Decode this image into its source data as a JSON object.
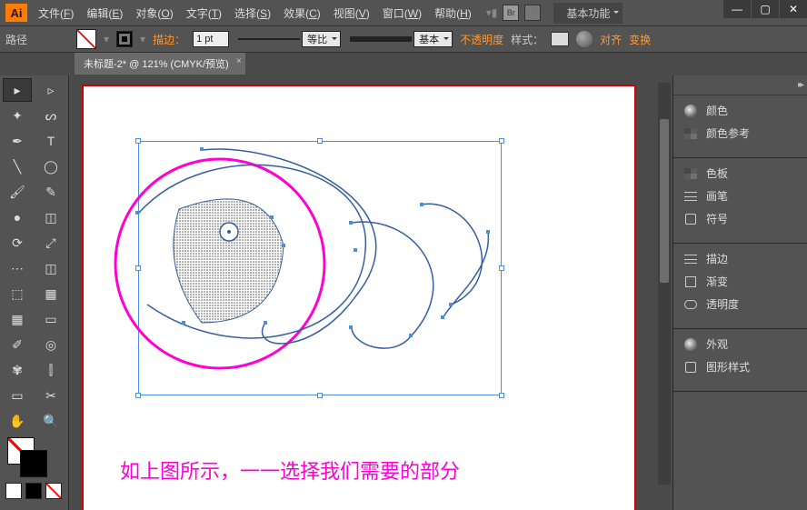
{
  "app_logo": "Ai",
  "menu": [
    {
      "label": "文件",
      "accel": "F"
    },
    {
      "label": "编辑",
      "accel": "E"
    },
    {
      "label": "对象",
      "accel": "O"
    },
    {
      "label": "文字",
      "accel": "T"
    },
    {
      "label": "选择",
      "accel": "S"
    },
    {
      "label": "效果",
      "accel": "C"
    },
    {
      "label": "视图",
      "accel": "V"
    },
    {
      "label": "窗口",
      "accel": "W"
    },
    {
      "label": "帮助",
      "accel": "H"
    }
  ],
  "workspace_label": "基本功能",
  "ctrl": {
    "object_label": "路径",
    "stroke_label": "描边：",
    "stroke_value": "1 pt",
    "profile_label": "等比",
    "brush_label": "基本",
    "opacity_label": "不透明度",
    "style_label": "样式：",
    "align_label": "对齐",
    "transform_label": "变换"
  },
  "tab_title": "未标题-2* @ 121% (CMYK/预览)",
  "caption": "如上图所示，一一选择我们需要的部分",
  "tools": [
    [
      "selection",
      "▸",
      "direct-select",
      "▹"
    ],
    [
      "magic-wand",
      "✦",
      "lasso",
      "ᔕ"
    ],
    [
      "pen",
      "✒",
      "type",
      "T"
    ],
    [
      "line",
      "╲",
      "ellipse",
      "◯"
    ],
    [
      "brush",
      "🖌",
      "pencil",
      "✎"
    ],
    [
      "blob",
      "●",
      "eraser",
      "◫"
    ],
    [
      "rotate",
      "⟳",
      "scale",
      "⤢"
    ],
    [
      "width",
      "⋯",
      "free-transform",
      "◫"
    ],
    [
      "shape-builder",
      "⬚",
      "perspective",
      "▦"
    ],
    [
      "mesh",
      "▦",
      "gradient",
      "▭"
    ],
    [
      "eyedropper",
      "✐",
      "blend",
      "◎"
    ],
    [
      "symbol-spray",
      "✾",
      "graph",
      "⫿"
    ],
    [
      "artboard",
      "▭",
      "slice",
      "✂"
    ],
    [
      "hand",
      "✋",
      "zoom",
      "🔍"
    ]
  ],
  "panels": {
    "group1": [
      {
        "id": "color",
        "label": "颜色",
        "icon": "pi-circle"
      },
      {
        "id": "color-guide",
        "label": "颜色参考",
        "icon": "pi-grid"
      }
    ],
    "group2": [
      {
        "id": "swatches",
        "label": "色板",
        "icon": "pi-grid"
      },
      {
        "id": "brushes",
        "label": "画笔",
        "icon": "pi-lines"
      },
      {
        "id": "symbols",
        "label": "符号",
        "icon": "pi-shape"
      }
    ],
    "group3": [
      {
        "id": "stroke",
        "label": "描边",
        "icon": "pi-lines"
      },
      {
        "id": "gradient",
        "label": "渐变",
        "icon": "pi-square"
      },
      {
        "id": "transparency",
        "label": "透明度",
        "icon": "pi-eye"
      }
    ],
    "group4": [
      {
        "id": "appearance",
        "label": "外观",
        "icon": "pi-circle"
      },
      {
        "id": "graphic-styles",
        "label": "图形样式",
        "icon": "pi-shape"
      }
    ]
  }
}
